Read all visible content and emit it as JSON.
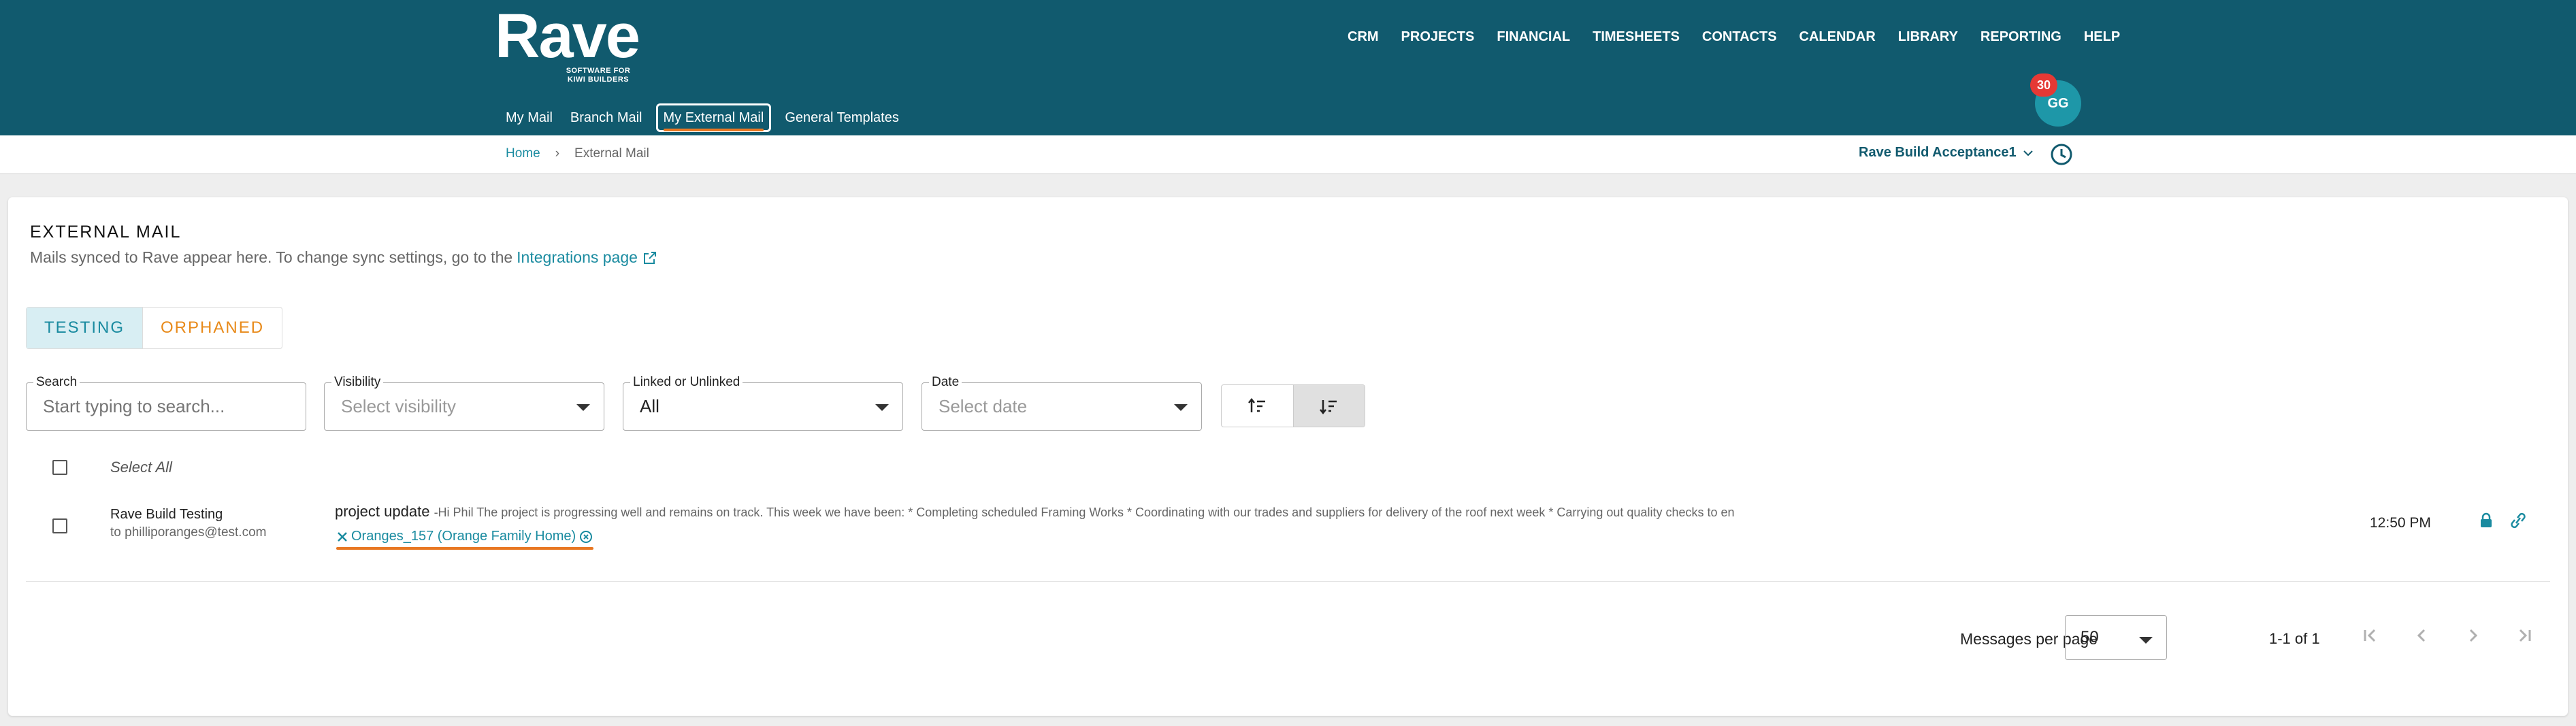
{
  "app": {
    "logo": "Rave",
    "tagline_1": "SOFTWARE FOR",
    "tagline_2": "KIWI BUILDERS"
  },
  "main_nav": [
    "CRM",
    "PROJECTS",
    "FINANCIAL",
    "TIMESHEETS",
    "CONTACTS",
    "CALENDAR",
    "LIBRARY",
    "REPORTING",
    "HELP"
  ],
  "mail_nav": {
    "my_mail": "My Mail",
    "branch_mail": "Branch Mail",
    "external_mail": "My External Mail",
    "templates": "General Templates"
  },
  "user": {
    "initials": "GG",
    "notifications": "30"
  },
  "breadcrumb": {
    "home": "Home",
    "current": "External Mail"
  },
  "company": "Rave Build Acceptance1",
  "page": {
    "title": "EXTERNAL MAIL",
    "subtitle": "Mails synced to Rave appear here. To change sync settings, go to the",
    "subtitle_link": "Integrations page"
  },
  "tabs": {
    "testing": "TESTING",
    "orphaned": "ORPHANED"
  },
  "filters": {
    "search_label": "Search",
    "search_placeholder": "Start typing to search...",
    "visibility_label": "Visibility",
    "visibility_value": "Select visibility",
    "linked_label": "Linked or Unlinked",
    "linked_value": "All",
    "date_label": "Date",
    "date_value": "Select date"
  },
  "list": {
    "select_all": "Select All",
    "rows": [
      {
        "from": "Rave Build Testing",
        "to": "to philliporanges@test.com",
        "subject": "project update",
        "preview": "-Hi Phil The project is progressing well and remains on track. This week we have been: * Completing scheduled Framing Works * Coordinating with our trades and suppliers for delivery of the roof next week * Carrying out quality checks to en",
        "link": "Oranges_157 (Orange Family Home)",
        "time": "12:50 PM"
      }
    ]
  },
  "pagination": {
    "per_page_label": "Messages per page",
    "per_page": "50",
    "range": "1-1 of 1"
  },
  "colors": {
    "header": "#115a6e",
    "accent": "#1a8ba0",
    "highlight": "#e87722",
    "badge": "#e53935"
  }
}
